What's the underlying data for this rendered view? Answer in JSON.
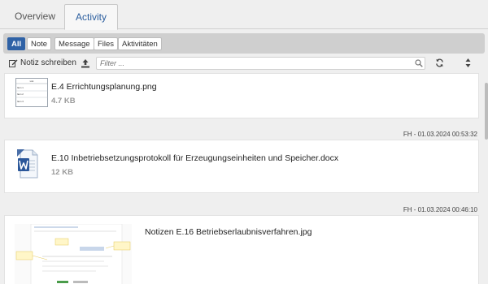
{
  "tabs": [
    {
      "label": "Overview"
    },
    {
      "label": "Activity"
    }
  ],
  "filters": [
    {
      "label": "All"
    },
    {
      "label": "Note"
    },
    {
      "label": "Message"
    },
    {
      "label": "Files"
    },
    {
      "label": "Aktivitäten"
    }
  ],
  "toolbar": {
    "write_label": "Notiz schreiben",
    "filter_placeholder": "Filter ..."
  },
  "items": [
    {
      "filename": "E.4 Errichtungsplanung.png",
      "size": "4.7 KB",
      "thumb": {
        "header": "List",
        "rows": [
          "Item 1",
          "Item 2",
          "Item 3"
        ]
      }
    },
    {
      "timestamp": "FH - 01.03.2024 00:53:32",
      "filename": "E.10 Inbetriebsetzungsprotokoll für Erzeugungseinheiten und Speicher.docx",
      "size": "12 KB"
    },
    {
      "timestamp": "FH - 01.03.2024 00:46:10",
      "filename": "Notizen E.16 Betriebserlaubnisverfahren.jpg"
    }
  ],
  "colors": {
    "accent": "#2f62a6",
    "word_blue": "#2b579a"
  }
}
